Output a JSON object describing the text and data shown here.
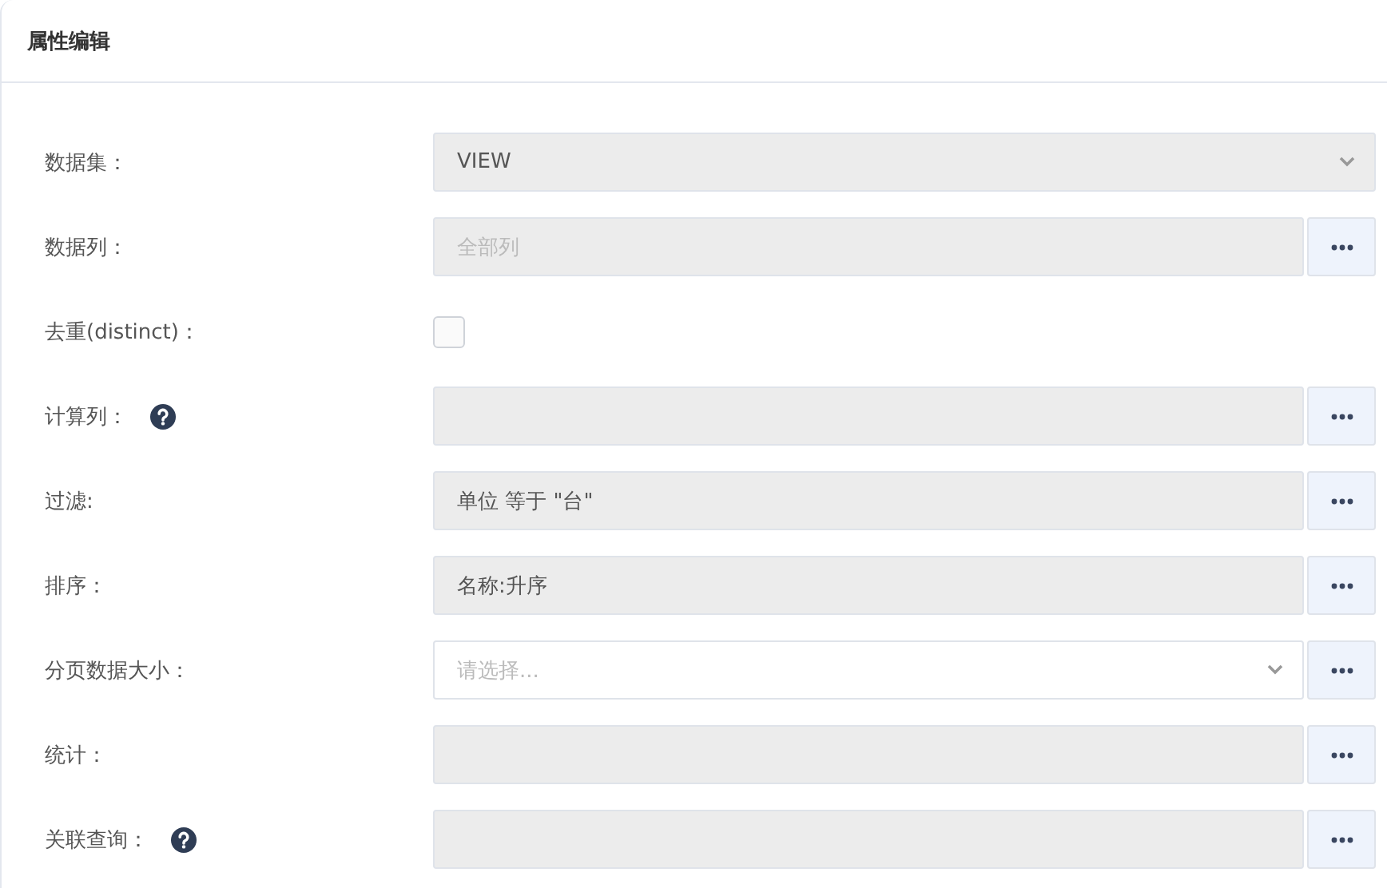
{
  "panel": {
    "title": "属性编辑"
  },
  "rows": [
    {
      "kind": "select",
      "label": "数据集：",
      "value": "VIEW",
      "disabled": true,
      "button": false,
      "help": false
    },
    {
      "kind": "text",
      "label": "数据列：",
      "placeholder": "全部列",
      "disabled": true,
      "button": true,
      "help": false
    },
    {
      "kind": "checkbox",
      "label": "去重(distinct)：",
      "checked": false,
      "help": false
    },
    {
      "kind": "text",
      "label": "计算列：",
      "disabled": true,
      "button": true,
      "help": true
    },
    {
      "kind": "text",
      "label": "过滤:",
      "value": "单位 等于 \"台\"",
      "disabled": true,
      "button": true,
      "help": false
    },
    {
      "kind": "text",
      "label": "排序：",
      "value": "名称:升序",
      "disabled": true,
      "button": true,
      "help": false
    },
    {
      "kind": "select",
      "label": "分页数据大小：",
      "placeholder": "请选择...",
      "disabled": false,
      "button": true,
      "help": false
    },
    {
      "kind": "text",
      "label": "统计：",
      "disabled": true,
      "button": true,
      "help": false
    },
    {
      "kind": "text",
      "label": "关联查询：",
      "disabled": true,
      "button": true,
      "help": true
    }
  ]
}
